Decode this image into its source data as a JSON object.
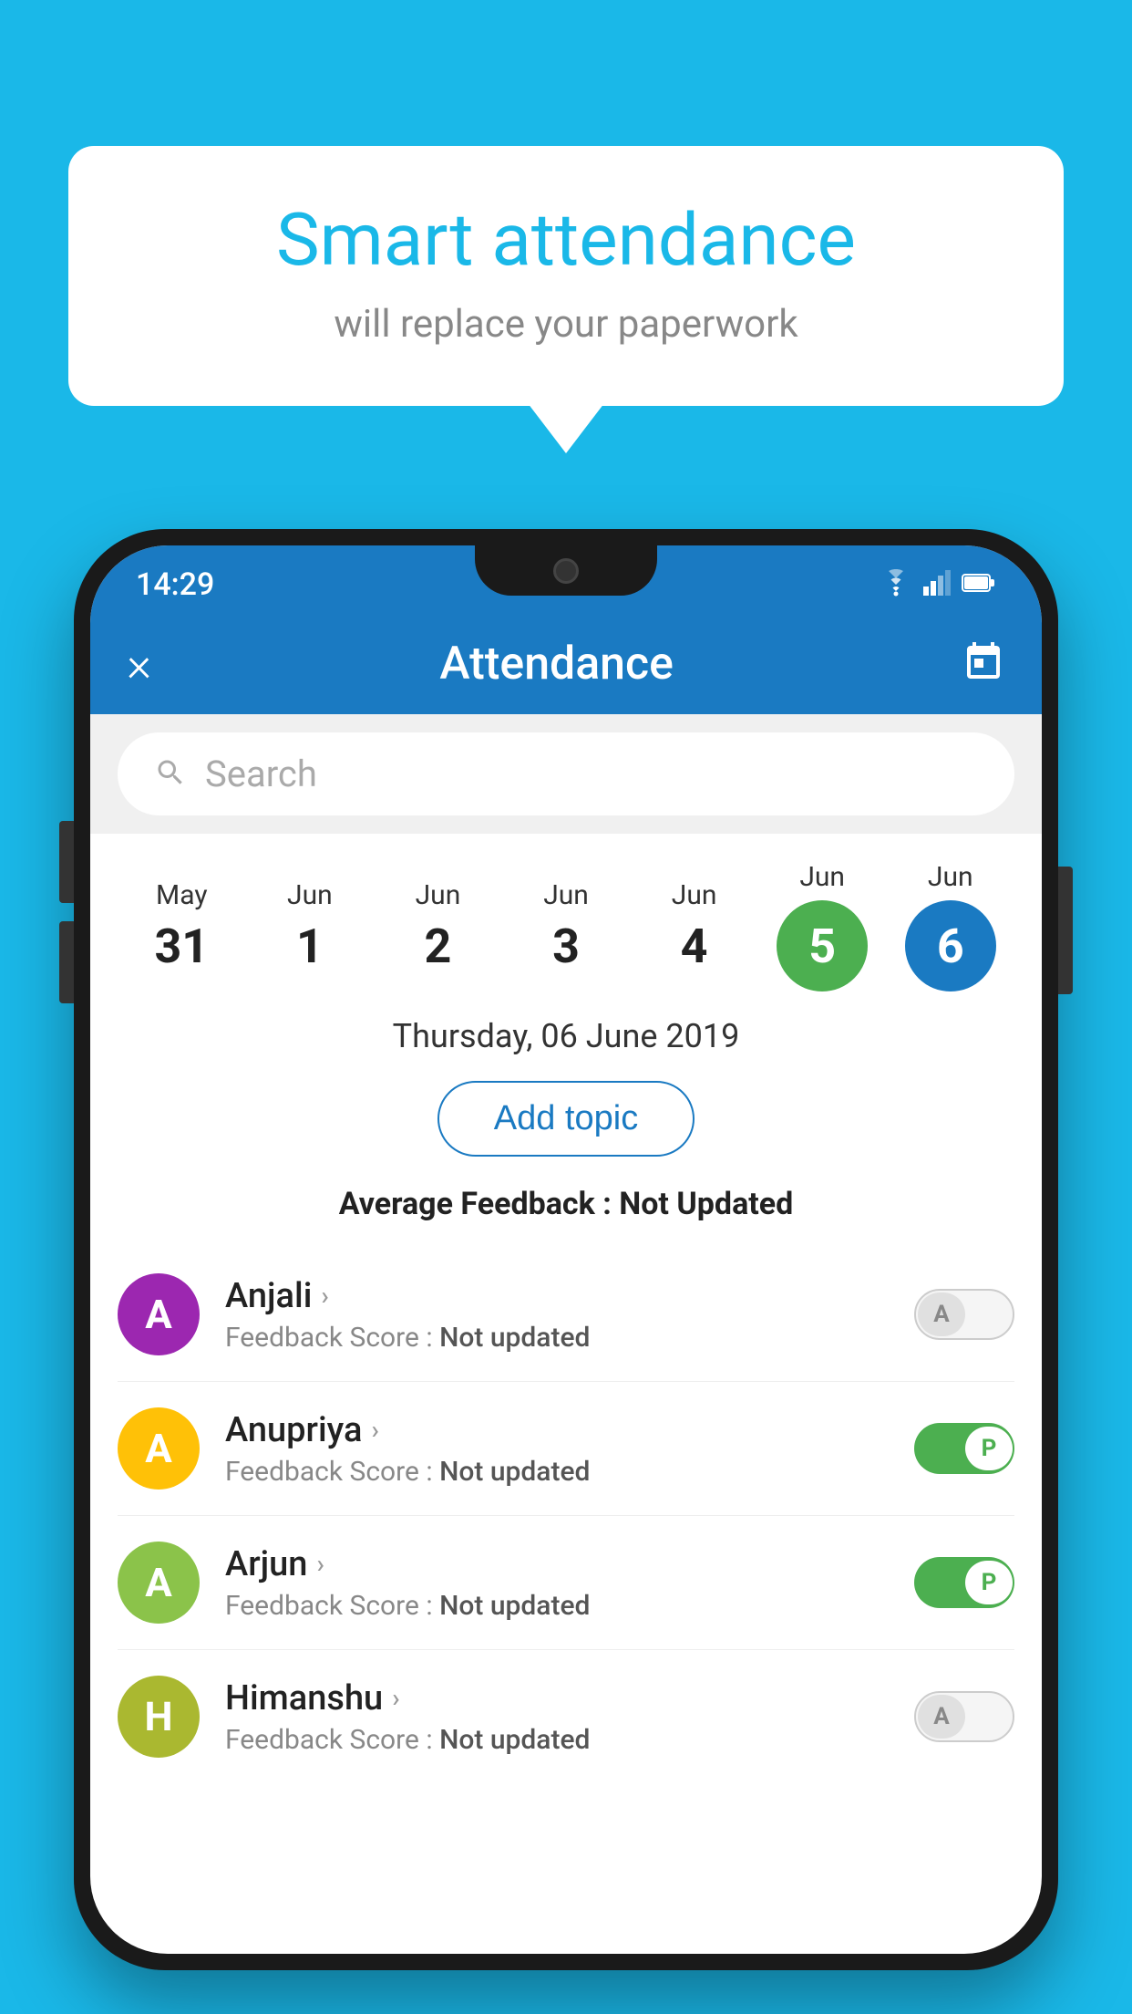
{
  "background_color": "#1ab8e8",
  "bubble": {
    "title": "Smart attendance",
    "subtitle": "will replace your paperwork"
  },
  "phone": {
    "status_bar": {
      "time": "14:29",
      "wifi": "▼",
      "signal": "▲",
      "battery": "▮"
    },
    "header": {
      "close_label": "×",
      "title": "Attendance",
      "calendar_icon": "calendar-icon"
    },
    "search": {
      "placeholder": "Search"
    },
    "dates": [
      {
        "month": "May",
        "day": "31",
        "type": "normal"
      },
      {
        "month": "Jun",
        "day": "1",
        "type": "normal"
      },
      {
        "month": "Jun",
        "day": "2",
        "type": "normal"
      },
      {
        "month": "Jun",
        "day": "3",
        "type": "normal"
      },
      {
        "month": "Jun",
        "day": "4",
        "type": "normal"
      },
      {
        "month": "Jun",
        "day": "5",
        "type": "green"
      },
      {
        "month": "Jun",
        "day": "6",
        "type": "blue"
      }
    ],
    "selected_date": "Thursday, 06 June 2019",
    "add_topic_label": "Add topic",
    "average_feedback_label": "Average Feedback :",
    "average_feedback_value": "Not Updated",
    "students": [
      {
        "name": "Anjali",
        "avatar_letter": "A",
        "avatar_color": "purple",
        "feedback_label": "Feedback Score :",
        "feedback_value": "Not updated",
        "attendance": "absent"
      },
      {
        "name": "Anupriya",
        "avatar_letter": "A",
        "avatar_color": "yellow",
        "feedback_label": "Feedback Score :",
        "feedback_value": "Not updated",
        "attendance": "present"
      },
      {
        "name": "Arjun",
        "avatar_letter": "A",
        "avatar_color": "green",
        "feedback_label": "Feedback Score :",
        "feedback_value": "Not updated",
        "attendance": "present"
      },
      {
        "name": "Himanshu",
        "avatar_letter": "H",
        "avatar_color": "olive",
        "feedback_label": "Feedback Score :",
        "feedback_value": "Not updated",
        "attendance": "absent"
      }
    ]
  }
}
